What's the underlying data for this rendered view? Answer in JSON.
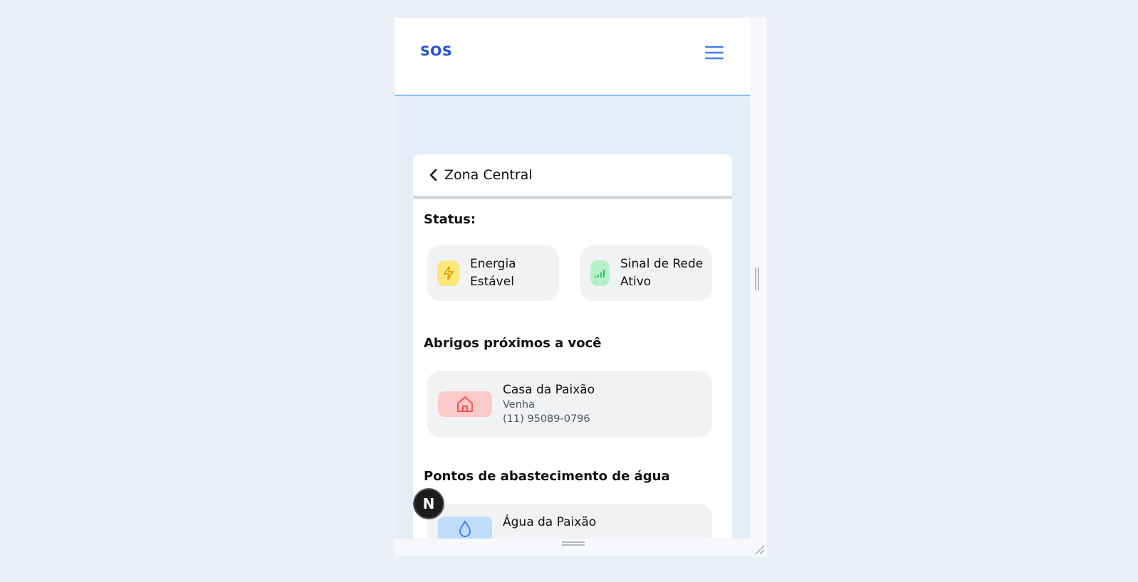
{
  "app": {
    "logo": "SOS"
  },
  "zone": {
    "title": "Zona Central"
  },
  "status": {
    "heading": "Status:",
    "items": [
      {
        "line1": "Energia",
        "line2": "Estável",
        "icon": "lightning-icon",
        "color": "#fbe77a"
      },
      {
        "line1": "Sinal de Rede",
        "line2": "Ativo",
        "icon": "signal-icon",
        "color": "#b5f0c9"
      }
    ]
  },
  "shelters": {
    "heading": "Abrigos próximos a você",
    "items": [
      {
        "name": "Casa da Paixão",
        "sub": "Venha",
        "phone": "(11) 95089-0796",
        "icon": "house-icon",
        "color": "#fdc9c9"
      }
    ]
  },
  "water": {
    "heading": "Pontos de abastecimento de água",
    "items": [
      {
        "name": "Água da Paixão",
        "icon": "water-drop-icon",
        "color": "#c2dcfb"
      }
    ]
  },
  "dev_badge": "N"
}
